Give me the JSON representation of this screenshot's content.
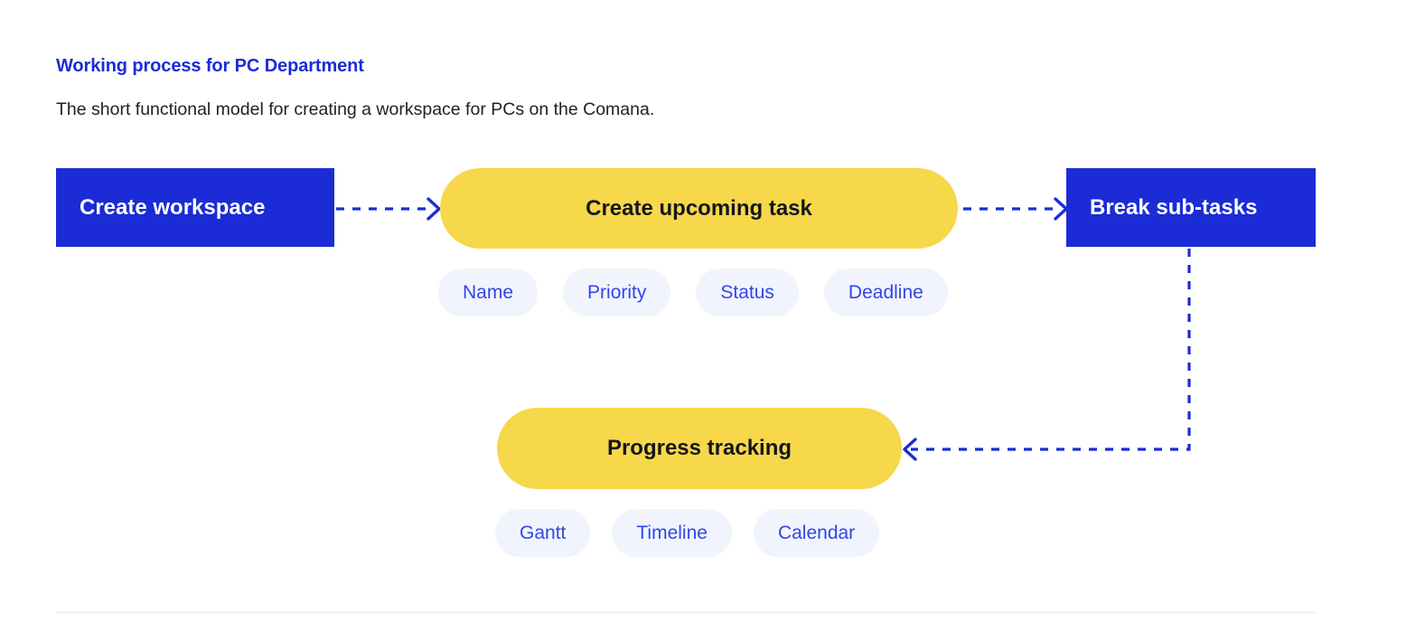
{
  "header": {
    "title": "Working process for PC Department",
    "subtitle": "The short functional model for creating a workspace for PCs on the Comana."
  },
  "colors": {
    "brand_blue": "#1B2CD6",
    "accent_yellow": "#F7D84A",
    "pill_background": "#F2F4FD",
    "pill_text": "#2F47E8",
    "node_text_dark": "#14161C",
    "node_text_light": "#FFFFFF",
    "divider": "#EEF1FC"
  },
  "diagram": {
    "nodes": {
      "create_workspace": {
        "label": "Create workspace",
        "shape": "rectangle",
        "fill": "blue"
      },
      "create_upcoming_task": {
        "label": "Create upcoming task",
        "shape": "pill",
        "fill": "yellow"
      },
      "break_sub_tasks": {
        "label": "Break sub-tasks",
        "shape": "rectangle",
        "fill": "blue"
      },
      "progress_tracking": {
        "label": "Progress tracking",
        "shape": "pill",
        "fill": "yellow"
      }
    },
    "task_attributes": [
      "Name",
      "Priority",
      "Status",
      "Deadline"
    ],
    "progress_views": [
      "Gantt",
      "Timeline",
      "Calendar"
    ],
    "connectors": [
      {
        "from": "create_workspace",
        "to": "create_upcoming_task",
        "style": "dashed",
        "direction": "right"
      },
      {
        "from": "create_upcoming_task",
        "to": "break_sub_tasks",
        "style": "dashed",
        "direction": "right"
      },
      {
        "from": "break_sub_tasks",
        "to": "progress_tracking",
        "style": "dashed",
        "direction": "down-left"
      }
    ]
  }
}
